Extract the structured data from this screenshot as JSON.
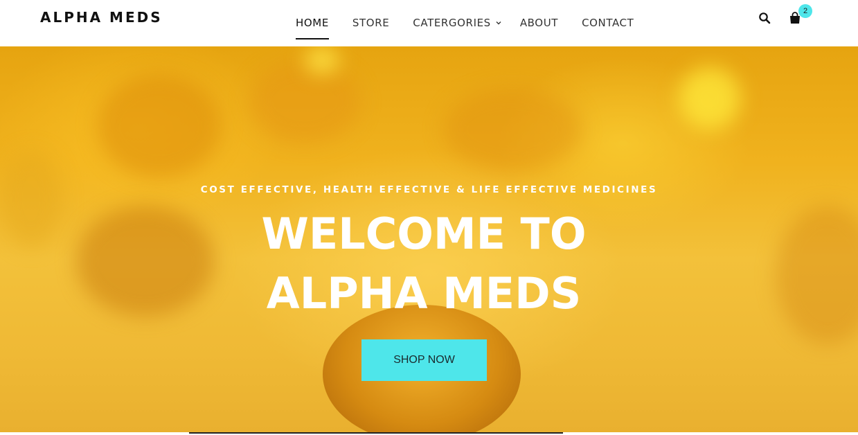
{
  "header": {
    "logo": "ALPHA MEDS",
    "nav": [
      {
        "label": "HOME",
        "active": true
      },
      {
        "label": "STORE",
        "active": false
      },
      {
        "label": "CATERGORIES",
        "active": false,
        "has_dropdown": true
      },
      {
        "label": "ABOUT",
        "active": false
      },
      {
        "label": "CONTACT",
        "active": false
      }
    ],
    "icons": {
      "search": "search-icon",
      "cart": "shopping-bag-icon",
      "dropdown": "chevron-down-icon"
    },
    "cart_count": "2"
  },
  "hero": {
    "subtitle": "COST EFFECTIVE, HEALTH EFFECTIVE & LIFE EFFECTIVE MEDICINES",
    "title_line1": "WELCOME TO",
    "title_line2": "ALPHA MEDS",
    "button_label": "SHOP NOW"
  },
  "colors": {
    "accent": "#4ee6ea",
    "hero_gold": "#f0b21e",
    "text_dark": "#111111",
    "text_white": "#ffffff"
  }
}
